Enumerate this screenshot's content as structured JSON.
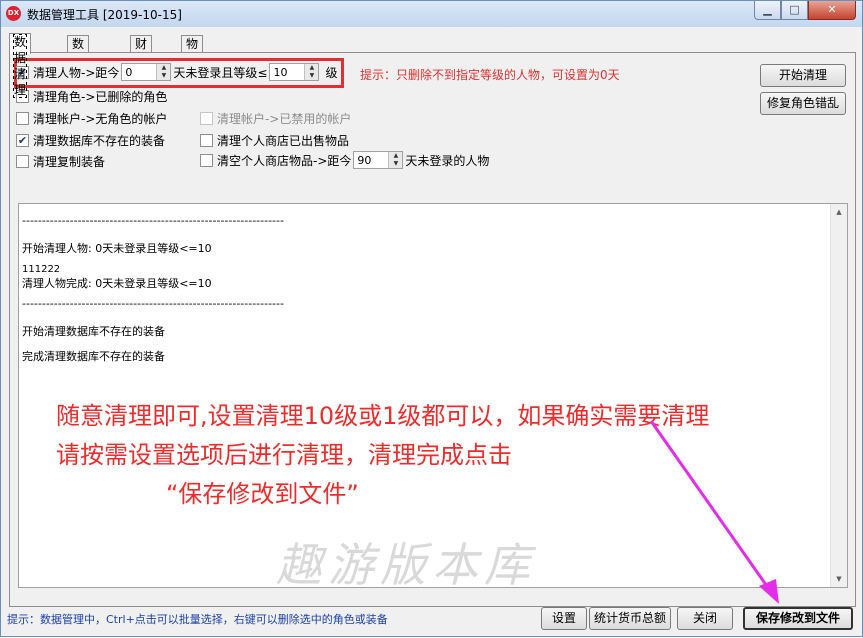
{
  "window": {
    "title": "数据管理工具 [2019-10-15]",
    "app_icon_text": "DX",
    "min_glyph": "▁",
    "max_glyph": "□",
    "close_glyph": "✕"
  },
  "tabs": [
    {
      "label": "数据清理",
      "active": true
    },
    {
      "label": "数据管理",
      "active": false
    },
    {
      "label": "财富榜",
      "active": false
    },
    {
      "label": "物品搜索",
      "active": false
    }
  ],
  "options": {
    "clean_player": {
      "checked": true,
      "prefix": "清理人物->距今",
      "days_value": "0",
      "middle": "天未登录且等级≤",
      "level_value": "10",
      "suffix": "级"
    },
    "hint": "提示：只删除不到指定等级的人物，可设置为0天",
    "clean_role": {
      "checked": false,
      "label": "清理角色->已删除的角色"
    },
    "clean_account_no_role": {
      "checked": false,
      "label": "清理帐户->无角色的帐户"
    },
    "clean_account_disabled": {
      "checked": false,
      "label": "清理帐户->已禁用的帐户",
      "disabled": true
    },
    "clean_missing_equip": {
      "checked": true,
      "label": "清理数据库不存在的装备"
    },
    "clean_shop_sold": {
      "checked": false,
      "label": "清理个人商店已出售物品"
    },
    "clean_duplicate_equip": {
      "checked": false,
      "label": "清理复制装备"
    },
    "clear_shop_items": {
      "checked": false,
      "prefix": "清空个人商店物品->距今",
      "days_value": "90",
      "suffix": "天未登录的人物"
    }
  },
  "buttons": {
    "start_clean": "开始清理",
    "repair_role": "修复角色错乱",
    "settings": "设置",
    "currency_stats": "统计货币总额",
    "close": "关闭",
    "save_to_file": "保存修改到文件"
  },
  "log_lines": [
    "------------------------------------------------------------------",
    "开始清理人物: 0天未登录且等级<=10",
    "111222",
    "清理人物完成: 0天未登录且等级<=10",
    "------------------------------------------------------------------",
    "开始清理数据库不存在的装备",
    "完成清理数据库不存在的装备"
  ],
  "annotation": {
    "line1": "随意清理即可,设置清理10级或1级都可以，如果确实需要清理",
    "line2": "请按需设置选项后进行清理，清理完成点击",
    "line3": "“保存修改到文件”",
    "arrow_color": "#e22ee6"
  },
  "watermark": "趣游版本库",
  "status_hint": "提示：数据管理中，Ctrl+点击可以批量选择，右键可以删除选中的角色或装备"
}
